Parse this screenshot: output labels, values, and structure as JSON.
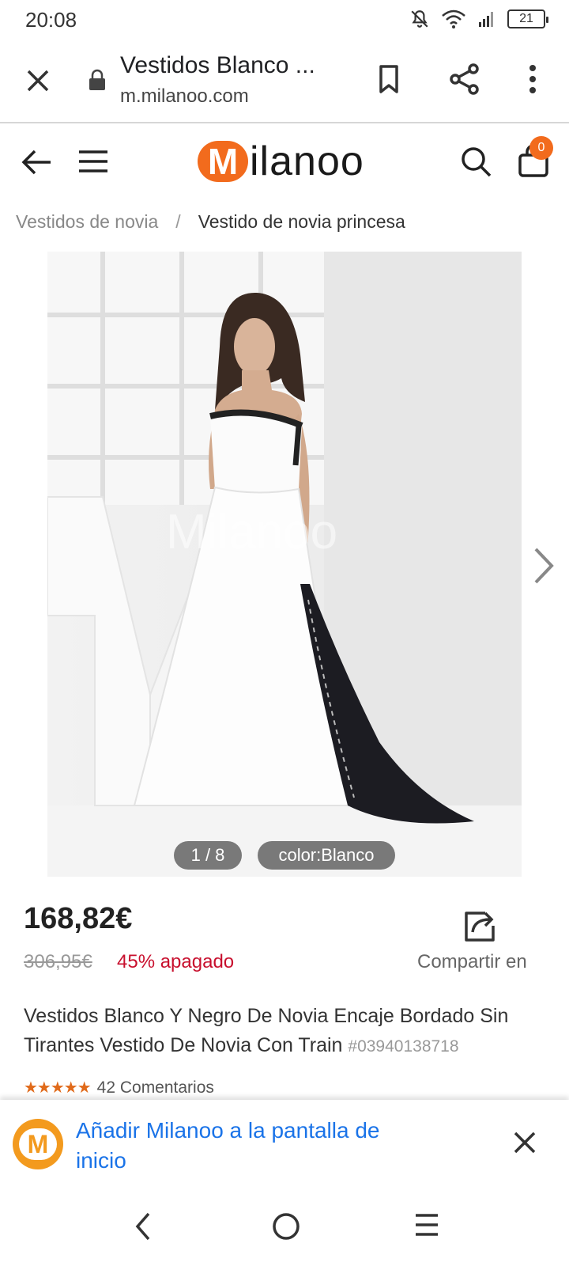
{
  "status_bar": {
    "time": "20:08",
    "battery": "21",
    "icons": [
      "mute-icon",
      "wifi-icon",
      "signal-icon",
      "battery-icon"
    ]
  },
  "browser": {
    "page_title": "Vestidos Blanco ...",
    "url": "m.milanoo.com",
    "icons": [
      "close-icon",
      "lock-icon",
      "bookmark-icon",
      "share-icon",
      "more-vert-icon"
    ]
  },
  "site_header": {
    "logo_letter": "M",
    "logo_text": "ilanoo",
    "cart_count": "0",
    "accent_color": "#f26b1d",
    "icons": [
      "back-arrow-icon",
      "hamburger-menu-icon",
      "search-icon",
      "cart-icon"
    ]
  },
  "breadcrumb": {
    "items": [
      "Vestidos de novia",
      "Vestido de novia princesa"
    ],
    "separator": "/"
  },
  "gallery": {
    "counter": "1 / 8",
    "color_label": "color:Blanco",
    "watermark": "Milanoo"
  },
  "product": {
    "price": "168,82€",
    "old_price": "306,95€",
    "discount": "45% apagado",
    "share_label": "Compartir en",
    "title": "Vestidos Blanco Y Negro De Novia Encaje Bordado Sin Tirantes Vestido De Novia Con Train ",
    "sku": "#03940138718",
    "stars": "★★★★★",
    "rating_value": 5,
    "reviews": "42 Comentarios"
  },
  "install_banner": {
    "text": "Añadir Milanoo a la pantalla de inicio",
    "logo_letter": "M",
    "color": "#1a73e8"
  },
  "nav_bar": {
    "icons": [
      "nav-back-icon",
      "nav-home-icon",
      "nav-recents-icon"
    ]
  }
}
